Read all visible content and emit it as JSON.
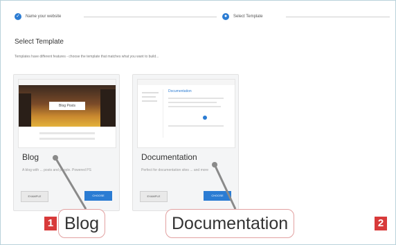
{
  "wizard": {
    "steps": [
      {
        "label": "Name your website",
        "icon": "check-icon"
      },
      {
        "label": "Select Template",
        "icon": "step-number-icon"
      }
    ]
  },
  "page": {
    "title": "Select Template",
    "subtitle": "Templates have different features - choose the template that matches what you want to build..."
  },
  "templates": [
    {
      "name": "Blog",
      "description": "A blog with ... posts and people. Powered PS",
      "thumbnail_title": "Blog Posts",
      "example_label": "EXAMPLE",
      "choose_label": "CHOOSE"
    },
    {
      "name": "Documentation",
      "description": "Perfect for documentation sites ... and more",
      "thumbnail_title": "Documentation",
      "example_label": "EXAMPLE",
      "choose_label": "CHOOSE"
    }
  ],
  "callouts": [
    {
      "number": "1",
      "label": "Blog"
    },
    {
      "number": "2",
      "label": "Documentation"
    }
  ],
  "colors": {
    "accent": "#2b7cd3",
    "badge": "#d83a3a",
    "background": "#cfe3ea"
  }
}
